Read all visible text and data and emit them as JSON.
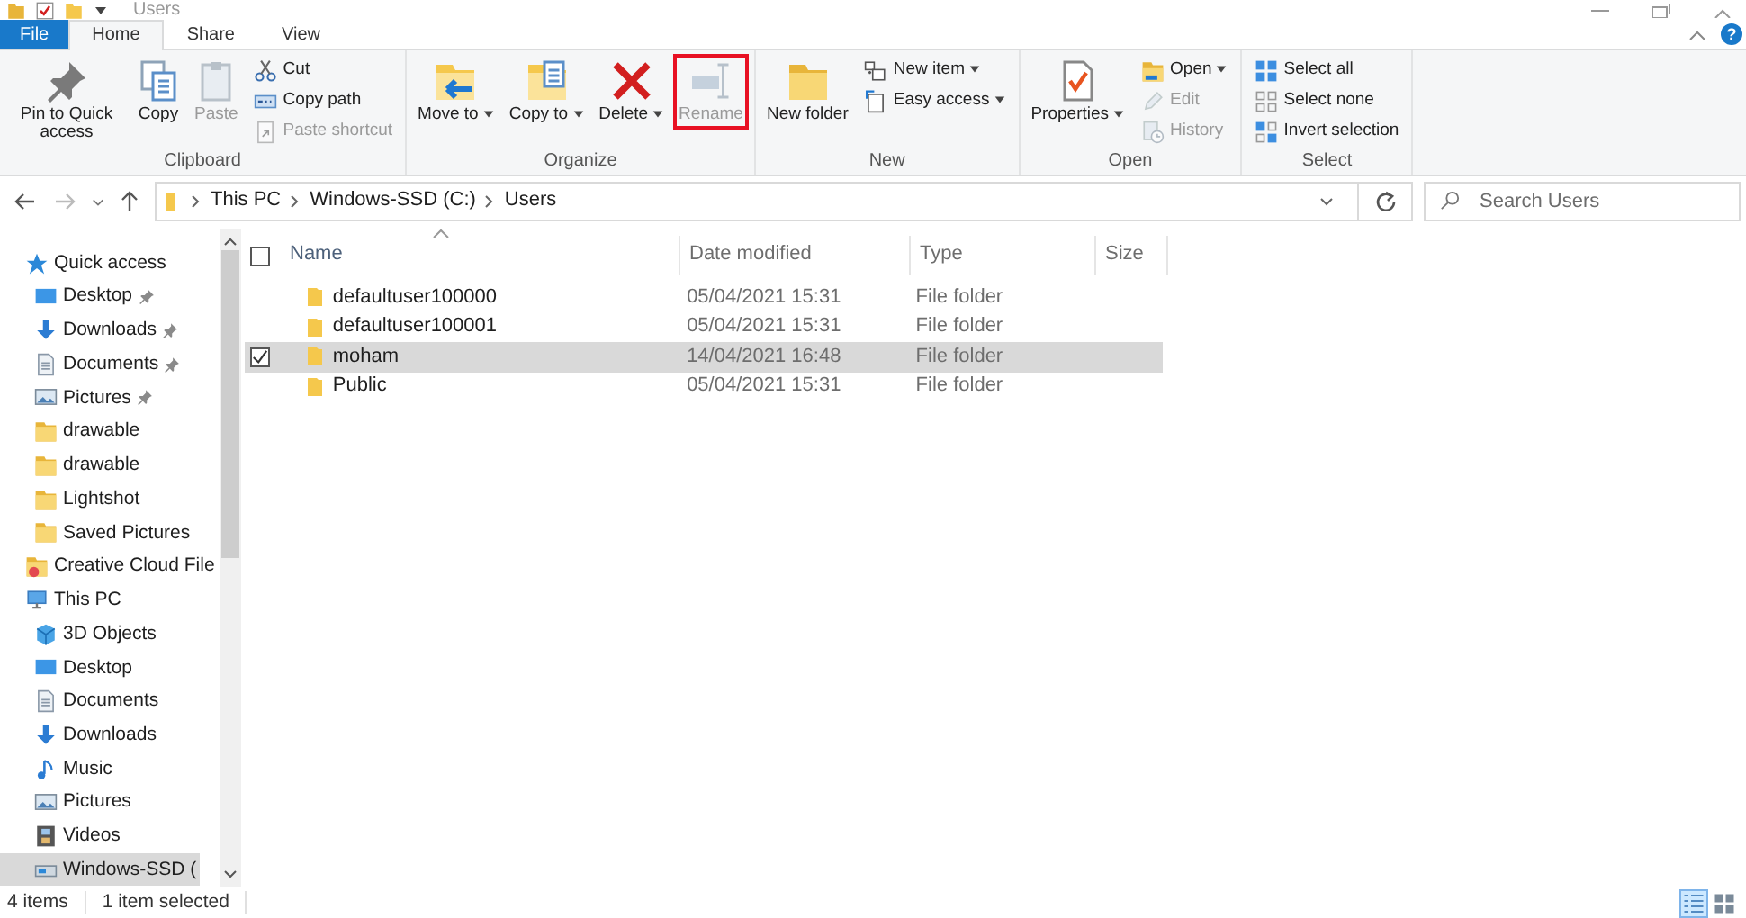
{
  "window": {
    "title": "Users",
    "help": "?"
  },
  "tabs": [
    {
      "label": "File",
      "kind": "menu",
      "selected": false
    },
    {
      "label": "Home",
      "kind": "tab",
      "selected": true
    },
    {
      "label": "Share",
      "kind": "tab",
      "selected": false
    },
    {
      "label": "View",
      "kind": "tab",
      "selected": false
    }
  ],
  "ribbon": {
    "groups": [
      {
        "label": "Clipboard",
        "large_buttons": [
          {
            "kind": "pin",
            "label": "Pin to Quick access",
            "dropdown": false,
            "disabled": false,
            "highlighted": false
          },
          {
            "kind": "copy",
            "label": "Copy",
            "dropdown": false,
            "disabled": false,
            "highlighted": false
          },
          {
            "kind": "paste",
            "label": "Paste",
            "dropdown": false,
            "disabled": true,
            "highlighted": false
          }
        ],
        "small_buttons": [
          {
            "kind": "cut",
            "label": "Cut",
            "dropdown": false,
            "disabled": false,
            "highlighted": false
          },
          {
            "kind": "copypath",
            "label": "Copy path",
            "dropdown": false,
            "disabled": false,
            "highlighted": false
          },
          {
            "kind": "pasteshortcut",
            "label": "Paste shortcut",
            "dropdown": false,
            "disabled": true,
            "highlighted": false
          }
        ]
      },
      {
        "label": "Organize",
        "large_buttons": [
          {
            "kind": "move",
            "label": "Move to",
            "dropdown": true,
            "disabled": false,
            "highlighted": false
          },
          {
            "kind": "copyto",
            "label": "Copy to",
            "dropdown": true,
            "disabled": false,
            "highlighted": false
          },
          {
            "kind": "delete",
            "label": "Delete",
            "dropdown": true,
            "disabled": false,
            "highlighted": false
          },
          {
            "kind": "rename",
            "label": "Rename",
            "dropdown": false,
            "disabled": true,
            "highlighted": true
          }
        ]
      },
      {
        "label": "New",
        "large_buttons": [
          {
            "kind": "folder",
            "label": "New folder",
            "dropdown": false,
            "disabled": false,
            "highlighted": false
          }
        ],
        "small_buttons": [
          {
            "kind": "newitem",
            "label": "New item",
            "dropdown": true,
            "disabled": false,
            "highlighted": false
          },
          {
            "kind": "easyaccess",
            "label": "Easy access",
            "dropdown": true,
            "disabled": false,
            "highlighted": false
          }
        ]
      },
      {
        "label": "Open",
        "large_buttons": [
          {
            "kind": "properties",
            "label": "Properties",
            "dropdown": true,
            "disabled": false,
            "highlighted": false
          }
        ],
        "small_buttons": [
          {
            "kind": "open",
            "label": "Open",
            "dropdown": true,
            "disabled": false,
            "highlighted": false
          },
          {
            "kind": "edit",
            "label": "Edit",
            "dropdown": false,
            "disabled": true,
            "highlighted": false
          },
          {
            "kind": "history",
            "label": "History",
            "dropdown": false,
            "disabled": true,
            "highlighted": false
          }
        ]
      },
      {
        "label": "Select",
        "small_buttons": [
          {
            "kind": "selectall",
            "label": "Select all",
            "dropdown": false,
            "disabled": false,
            "highlighted": false
          },
          {
            "kind": "selectnone",
            "label": "Select none",
            "dropdown": false,
            "disabled": false,
            "highlighted": false
          },
          {
            "kind": "invert",
            "label": "Invert selection",
            "dropdown": false,
            "disabled": false,
            "highlighted": false
          }
        ]
      }
    ]
  },
  "address": {
    "crumbs": [
      "This PC",
      "Windows-SSD (C:)",
      "Users"
    ],
    "search_placeholder": "Search Users"
  },
  "navigation": [
    {
      "label": "Quick access",
      "kind": "star",
      "selected": false,
      "pinned": false,
      "children": [
        {
          "label": "Desktop",
          "kind": "desktop",
          "selected": false,
          "pinned": true
        },
        {
          "label": "Downloads",
          "kind": "download",
          "selected": false,
          "pinned": true
        },
        {
          "label": "Documents",
          "kind": "document",
          "selected": false,
          "pinned": true
        },
        {
          "label": "Pictures",
          "kind": "picture",
          "selected": false,
          "pinned": true
        },
        {
          "label": "drawable",
          "kind": "folder",
          "selected": false,
          "pinned": false
        },
        {
          "label": "drawable",
          "kind": "folder",
          "selected": false,
          "pinned": false
        },
        {
          "label": "Lightshot",
          "kind": "folder",
          "selected": false,
          "pinned": false
        },
        {
          "label": "Saved Pictures",
          "kind": "folder",
          "selected": false,
          "pinned": false
        }
      ]
    },
    {
      "label": "Creative Cloud File",
      "kind": "cloud",
      "selected": false,
      "pinned": false
    },
    {
      "label": "This PC",
      "kind": "pc",
      "selected": false,
      "pinned": false,
      "children": [
        {
          "label": "3D Objects",
          "kind": "cube",
          "selected": false,
          "pinned": false
        },
        {
          "label": "Desktop",
          "kind": "desktop",
          "selected": false,
          "pinned": false
        },
        {
          "label": "Documents",
          "kind": "document",
          "selected": false,
          "pinned": false
        },
        {
          "label": "Downloads",
          "kind": "download",
          "selected": false,
          "pinned": false
        },
        {
          "label": "Music",
          "kind": "music",
          "selected": false,
          "pinned": false
        },
        {
          "label": "Pictures",
          "kind": "picture",
          "selected": false,
          "pinned": false
        },
        {
          "label": "Videos",
          "kind": "video",
          "selected": false,
          "pinned": false
        },
        {
          "label": "Windows-SSD (",
          "kind": "drive",
          "selected": true,
          "pinned": false
        }
      ]
    }
  ],
  "files": {
    "select_all_checked": false,
    "columns": [
      "Name",
      "Date modified",
      "Type",
      "Size"
    ],
    "rows": [
      {
        "name": "defaultuser100000",
        "date": "05/04/2021 15:31",
        "type": "File folder",
        "selected": false,
        "checked": false
      },
      {
        "name": "defaultuser100001",
        "date": "05/04/2021 15:31",
        "type": "File folder",
        "selected": false,
        "checked": false
      },
      {
        "name": "moham",
        "date": "14/04/2021 16:48",
        "type": "File folder",
        "selected": true,
        "checked": true
      },
      {
        "name": "Public",
        "date": "05/04/2021 15:31",
        "type": "File folder",
        "selected": false,
        "checked": false
      }
    ]
  },
  "status_bar": {
    "items": [
      "4 items",
      "1 item selected"
    ],
    "views": [
      {
        "kind": "details",
        "selected": true
      },
      {
        "kind": "tiles",
        "selected": false
      }
    ]
  }
}
